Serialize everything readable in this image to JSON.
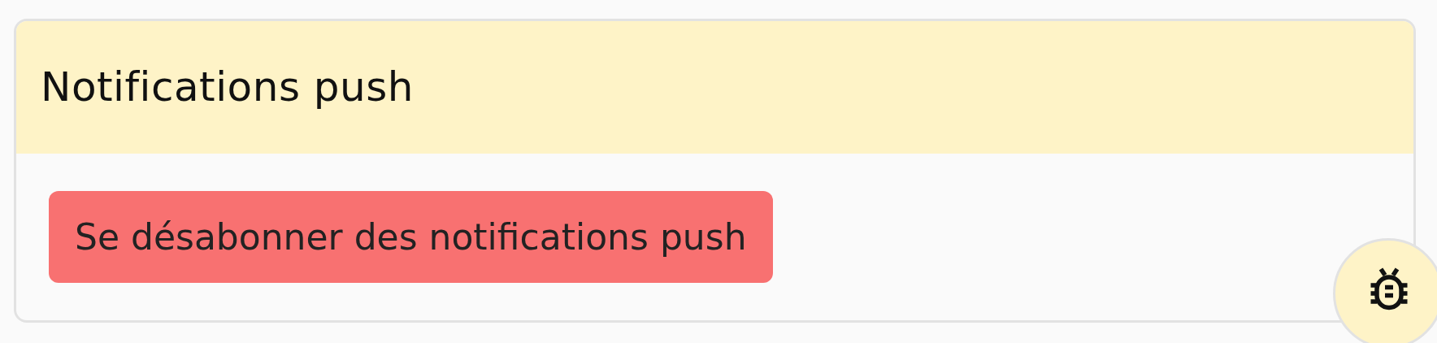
{
  "card": {
    "title": "Notifications push",
    "button": {
      "label": "Se désabonner des notifications push"
    }
  }
}
